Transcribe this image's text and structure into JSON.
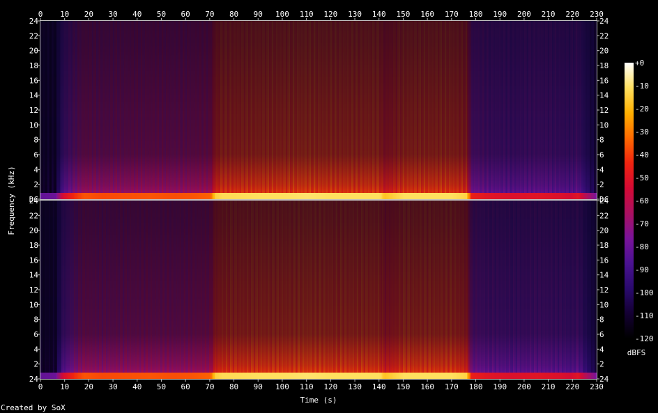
{
  "chart_data": {
    "type": "heatmap",
    "xlabel": "Time (s)",
    "ylabel": "Frequency (kHz)",
    "x_range": [
      0,
      230
    ],
    "x_ticks": [
      0,
      10,
      20,
      30,
      40,
      50,
      60,
      70,
      80,
      90,
      100,
      110,
      120,
      130,
      140,
      150,
      160,
      170,
      180,
      190,
      200,
      210,
      220,
      230
    ],
    "channels": [
      {
        "y_range": [
          0,
          24
        ],
        "y_ticks": [
          {
            "value": 0,
            "label": "DC"
          },
          {
            "value": 2,
            "label": "2"
          },
          {
            "value": 4,
            "label": "4"
          },
          {
            "value": 6,
            "label": "6"
          },
          {
            "value": 8,
            "label": "8"
          },
          {
            "value": 10,
            "label": "10"
          },
          {
            "value": 12,
            "label": "12"
          },
          {
            "value": 14,
            "label": "14"
          },
          {
            "value": 16,
            "label": "16"
          },
          {
            "value": 18,
            "label": "18"
          },
          {
            "value": 20,
            "label": "20"
          },
          {
            "value": 22,
            "label": "22"
          },
          {
            "value": 24,
            "label": "24"
          }
        ]
      },
      {
        "y_range": [
          0,
          24
        ],
        "y_ticks": [
          {
            "value": 0,
            "label": "24"
          },
          {
            "value": 2,
            "label": "2"
          },
          {
            "value": 4,
            "label": "4"
          },
          {
            "value": 6,
            "label": "6"
          },
          {
            "value": 8,
            "label": "8"
          },
          {
            "value": 10,
            "label": "10"
          },
          {
            "value": 12,
            "label": "12"
          },
          {
            "value": 14,
            "label": "14"
          },
          {
            "value": 16,
            "label": "16"
          },
          {
            "value": 18,
            "label": "18"
          },
          {
            "value": 20,
            "label": "20"
          },
          {
            "value": 22,
            "label": "22"
          },
          {
            "value": 24,
            "label": "24"
          }
        ]
      }
    ],
    "intensity": {
      "unit": "dBFS",
      "range": [
        -120,
        0
      ],
      "ticks": [
        {
          "value": 0,
          "label": "+0"
        },
        {
          "value": -10,
          "label": "-10"
        },
        {
          "value": -20,
          "label": "-20"
        },
        {
          "value": -30,
          "label": "-30"
        },
        {
          "value": -40,
          "label": "-40"
        },
        {
          "value": -50,
          "label": "-50"
        },
        {
          "value": -60,
          "label": "-60"
        },
        {
          "value": -70,
          "label": "-70"
        },
        {
          "value": -80,
          "label": "-80"
        },
        {
          "value": -90,
          "label": "-90"
        },
        {
          "value": -100,
          "label": "-100"
        },
        {
          "value": -110,
          "label": "-110"
        },
        {
          "value": -120,
          "label": "-120"
        }
      ],
      "colormap": [
        "#000000",
        "#140033",
        "#2a0a6e",
        "#4a1292",
        "#7a1399",
        "#aa1060",
        "#d40a34",
        "#f0240f",
        "#ff6a00",
        "#ffb000",
        "#ffe060",
        "#ffffff"
      ]
    },
    "colorbar_label": "dBFS",
    "loudness_profile": {
      "time_s": [
        0,
        6,
        9,
        14,
        18,
        25,
        35,
        45,
        55,
        63,
        70,
        72,
        75,
        80,
        90,
        100,
        110,
        120,
        130,
        140,
        142,
        150,
        160,
        170,
        176,
        178,
        185,
        195,
        205,
        215,
        219,
        222,
        225,
        230
      ],
      "level_dbfs": [
        -112,
        -110,
        -84,
        -72,
        -66,
        -68,
        -67,
        -66,
        -67,
        -66,
        -64,
        -45,
        -42,
        -42,
        -41,
        -41,
        -40,
        -41,
        -41,
        -41,
        -48,
        -41,
        -41,
        -41,
        -44,
        -76,
        -80,
        -82,
        -80,
        -82,
        -84,
        -80,
        -92,
        -108
      ]
    },
    "grid": false
  },
  "footer": {
    "credit": "Created by SoX"
  }
}
